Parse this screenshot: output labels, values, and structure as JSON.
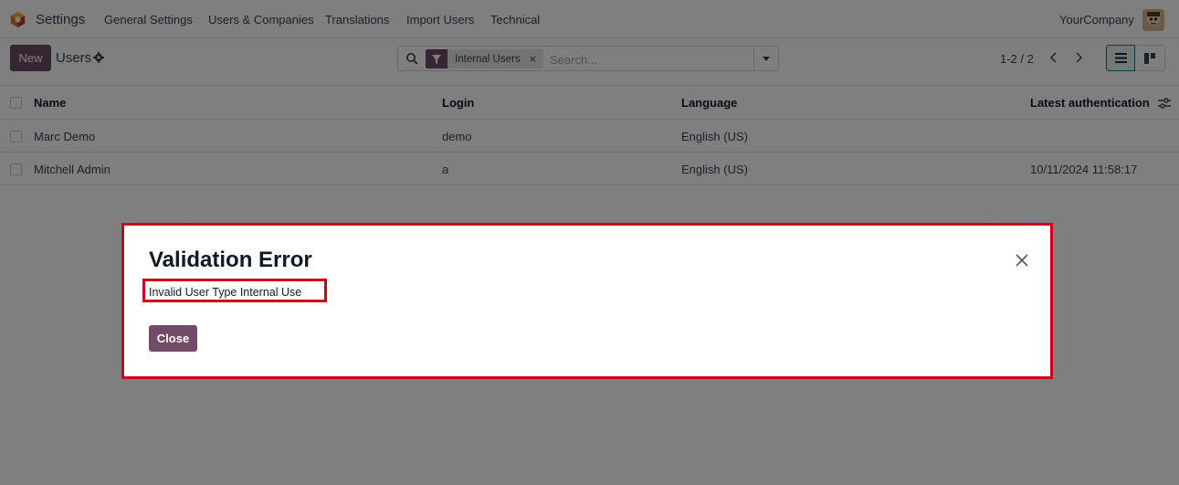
{
  "topbar": {
    "app_name": "Settings",
    "menu": [
      "General Settings",
      "Users & Companies",
      "Translations",
      "Import Users",
      "Technical"
    ],
    "company": "YourCompany"
  },
  "controlbar": {
    "new_label": "New",
    "title": "Users",
    "search": {
      "facet_label": "Internal Users",
      "facet_remove": "×",
      "placeholder": "Search..."
    },
    "pager": "1-2 / 2"
  },
  "table": {
    "columns": [
      "Name",
      "Login",
      "Language",
      "Latest authentication"
    ],
    "rows": [
      {
        "name": "Marc Demo",
        "login": "demo",
        "language": "English (US)",
        "latest_auth": ""
      },
      {
        "name": "Mitchell Admin",
        "login": "a",
        "language": "English (US)",
        "latest_auth": "10/11/2024 11:58:17"
      }
    ]
  },
  "dialog": {
    "title": "Validation Error",
    "message": "Invalid User Type Internal Use",
    "close_label": "Close"
  },
  "colors": {
    "brand": "#714b67",
    "highlight": "#d0021b",
    "view_active": "#017e84"
  },
  "icons": [
    "odoo-logo-icon",
    "gear-icon",
    "search-icon",
    "filter-icon",
    "close-icon",
    "caret-down-icon",
    "chevron-left-icon",
    "chevron-right-icon",
    "list-view-icon",
    "kanban-view-icon",
    "optional-columns-icon",
    "avatar"
  ]
}
